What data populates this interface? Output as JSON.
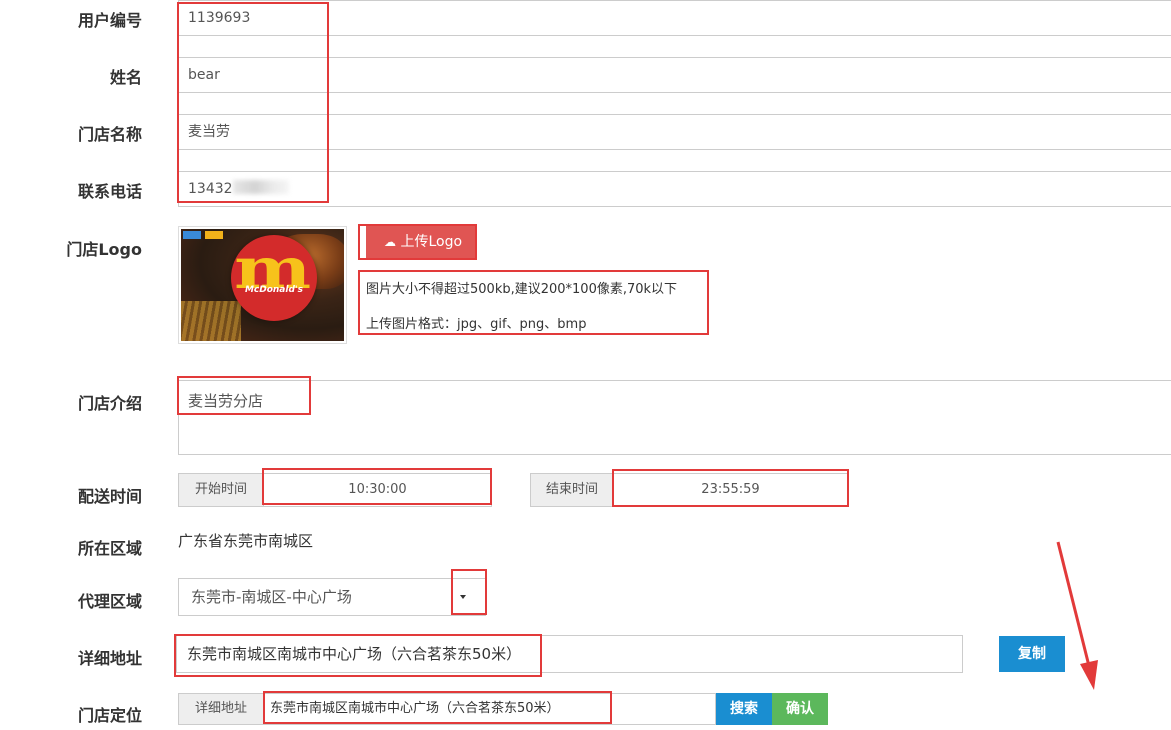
{
  "form": {
    "user_id": {
      "label": "用户编号",
      "value": "1139693"
    },
    "name": {
      "label": "姓名",
      "value": "bear"
    },
    "store_name": {
      "label": "门店名称",
      "value": "麦当劳"
    },
    "phone": {
      "label": "联系电话",
      "value": "13432"
    },
    "logo": {
      "label": "门店Logo",
      "image_text": "McDonald's",
      "upload_label": "上传Logo",
      "hint_size": "图片大小不得超过500kb,建议200*100像素,70k以下",
      "hint_format": "上传图片格式：jpg、gif、png、bmp"
    },
    "intro": {
      "label": "门店介绍",
      "value": "麦当劳分店"
    },
    "delivery": {
      "label": "配送时间",
      "start_label": "开始时间",
      "start_value": "10:30:00",
      "end_label": "结束时间",
      "end_value": "23:55:59"
    },
    "region": {
      "label": "所在区域",
      "value": "广东省东莞市南城区"
    },
    "agent_region": {
      "label": "代理区域",
      "selected": "东莞市-南城区-中心广场"
    },
    "address": {
      "label": "详细地址",
      "value": "东莞市南城区南城市中心广场（六合茗茶东50米）",
      "copy_label": "复制"
    },
    "location": {
      "label": "门店定位",
      "addon_label": "详细地址",
      "value": "东莞市南城区南城市中心广场（六合茗茶东50米）",
      "search_label": "搜索",
      "confirm_label": "确认"
    }
  },
  "colors": {
    "highlight": "#e23a3a",
    "upload_button": "#e05553",
    "primary_button": "#1a8ed1",
    "confirm_button": "#5cb85c"
  }
}
